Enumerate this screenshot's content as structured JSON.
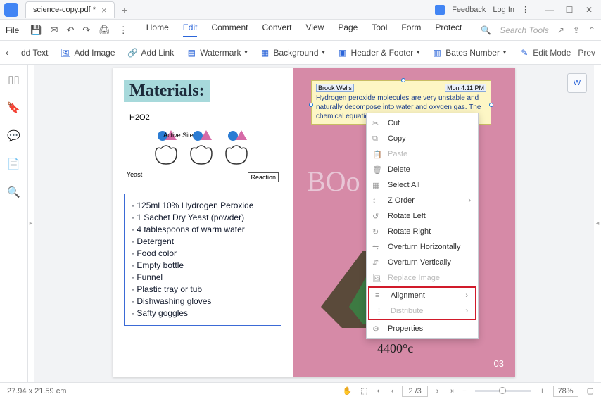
{
  "titlebar": {
    "tab_name": "science-copy.pdf *",
    "feedback": "Feedback",
    "login": "Log In"
  },
  "menu": {
    "file": "File",
    "items": [
      "Home",
      "Edit",
      "Comment",
      "Convert",
      "View",
      "Page",
      "Tool",
      "Form",
      "Protect"
    ],
    "active": 1,
    "search_placeholder": "Search Tools"
  },
  "toolbar": {
    "add_text": "dd Text",
    "add_image": "Add Image",
    "add_link": "Add Link",
    "watermark": "Watermark",
    "background": "Background",
    "header_footer": "Header & Footer",
    "bates": "Bates Number",
    "edit_mode": "Edit Mode",
    "preview": "Prev"
  },
  "doc": {
    "materials_title": "Materials:",
    "diagram": {
      "h2o2": "H2O2",
      "active_site": "Active Site",
      "yeast": "Yeast",
      "reaction": "Reaction"
    },
    "list": [
      "125ml 10% Hydrogen Peroxide",
      "1 Sachet Dry Yeast (powder)",
      "4 tablespoons of warm water",
      "Detergent",
      "Food color",
      "Empty bottle",
      "Funnel",
      "Plastic tray or tub",
      "Dishwashing gloves",
      "Safty goggles"
    ],
    "sticky": {
      "author": "Brook Wells",
      "time": "Mon 4:11 PM",
      "body": "Hydrogen peroxide molecules are very unstable and naturally decompose into water and oxygen gas. The chemical equation for this decompostion is:"
    },
    "boo": "BOo",
    "temperature": "4400°c",
    "page_num": "03"
  },
  "context_menu": {
    "cut": "Cut",
    "copy": "Copy",
    "paste": "Paste",
    "del": "Delete",
    "select_all": "Select All",
    "z_order": "Z Order",
    "rotate_left": "Rotate Left",
    "rotate_right": "Rotate Right",
    "over_h": "Overturn Horizontally",
    "over_v": "Overturn Vertically",
    "replace_image": "Replace Image",
    "alignment": "Alignment",
    "distribute": "Distribute",
    "properties": "Properties"
  },
  "status": {
    "dims": "27.94 x 21.59 cm",
    "page_indicator": "2 /3",
    "zoom": "78%"
  }
}
